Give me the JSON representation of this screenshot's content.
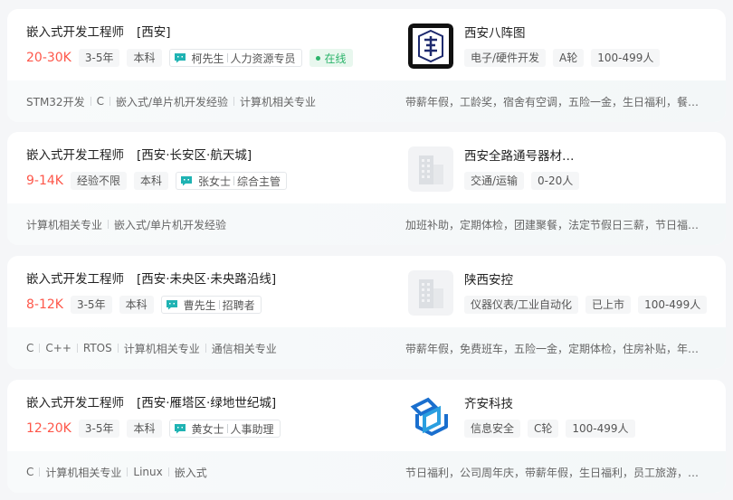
{
  "jobs": [
    {
      "title": "嵌入式开发工程师",
      "area": "[西安]",
      "salary": "20-30K",
      "tags": [
        "3-5年",
        "本科"
      ],
      "boss": {
        "name": "柯先生",
        "role": "人力资源专员"
      },
      "online": "在线",
      "skills": [
        "STM32开发",
        "C",
        "嵌入式/单片机开发经验",
        "计算机相关专业"
      ],
      "company": {
        "name": "西安八阵图",
        "tags": [
          "电子/硬件开发",
          "A轮",
          "100-499人"
        ],
        "logo": "baziantu-logo"
      },
      "welfare": "带薪年假，工龄奖，宿舍有空调，五险一金，生日福利，餐…"
    },
    {
      "title": "嵌入式开发工程师",
      "area": "[西安·长安区·航天城]",
      "salary": "9-14K",
      "tags": [
        "经验不限",
        "本科"
      ],
      "boss": {
        "name": "张女士",
        "role": "综合主管"
      },
      "skills": [
        "计算机相关专业",
        "嵌入式/单片机开发经验"
      ],
      "company": {
        "name": "西安全路通号器材…",
        "tags": [
          "交通/运输",
          "0-20人"
        ],
        "logo": "building-placeholder-icon"
      },
      "welfare": "加班补助，定期体检，团建聚餐，法定节假日三薪，节日福…"
    },
    {
      "title": "嵌入式开发工程师",
      "area": "[西安·未央区·未央路沿线]",
      "salary": "8-12K",
      "tags": [
        "3-5年",
        "本科"
      ],
      "boss": {
        "name": "曹先生",
        "role": "招聘者"
      },
      "skills": [
        "C",
        "C++",
        "RTOS",
        "计算机相关专业",
        "通信相关专业"
      ],
      "company": {
        "name": "陕西安控",
        "tags": [
          "仪器仪表/工业自动化",
          "已上市",
          "100-499人"
        ],
        "logo": "building-placeholder-icon"
      },
      "welfare": "带薪年假，免费班车，五险一金，定期体检，住房补贴，年…"
    },
    {
      "title": "嵌入式开发工程师",
      "area": "[西安·雁塔区·绿地世纪城]",
      "salary": "12-20K",
      "tags": [
        "3-5年",
        "本科"
      ],
      "boss": {
        "name": "黄女士",
        "role": "人事助理"
      },
      "skills": [
        "C",
        "计算机相关专业",
        "Linux",
        "嵌入式"
      ],
      "company": {
        "name": "齐安科技",
        "tags": [
          "信息安全",
          "C轮",
          "100-499人"
        ],
        "logo": "qian-tech-logo"
      },
      "welfare": "节日福利，公司周年庆，带薪年假，生日福利，员工旅游，…"
    }
  ],
  "colors": {
    "salary": "#fe574a",
    "online": "#2cb46b",
    "chat_icon": "#1fb3b3",
    "brand_blue": "#1a6fce"
  }
}
